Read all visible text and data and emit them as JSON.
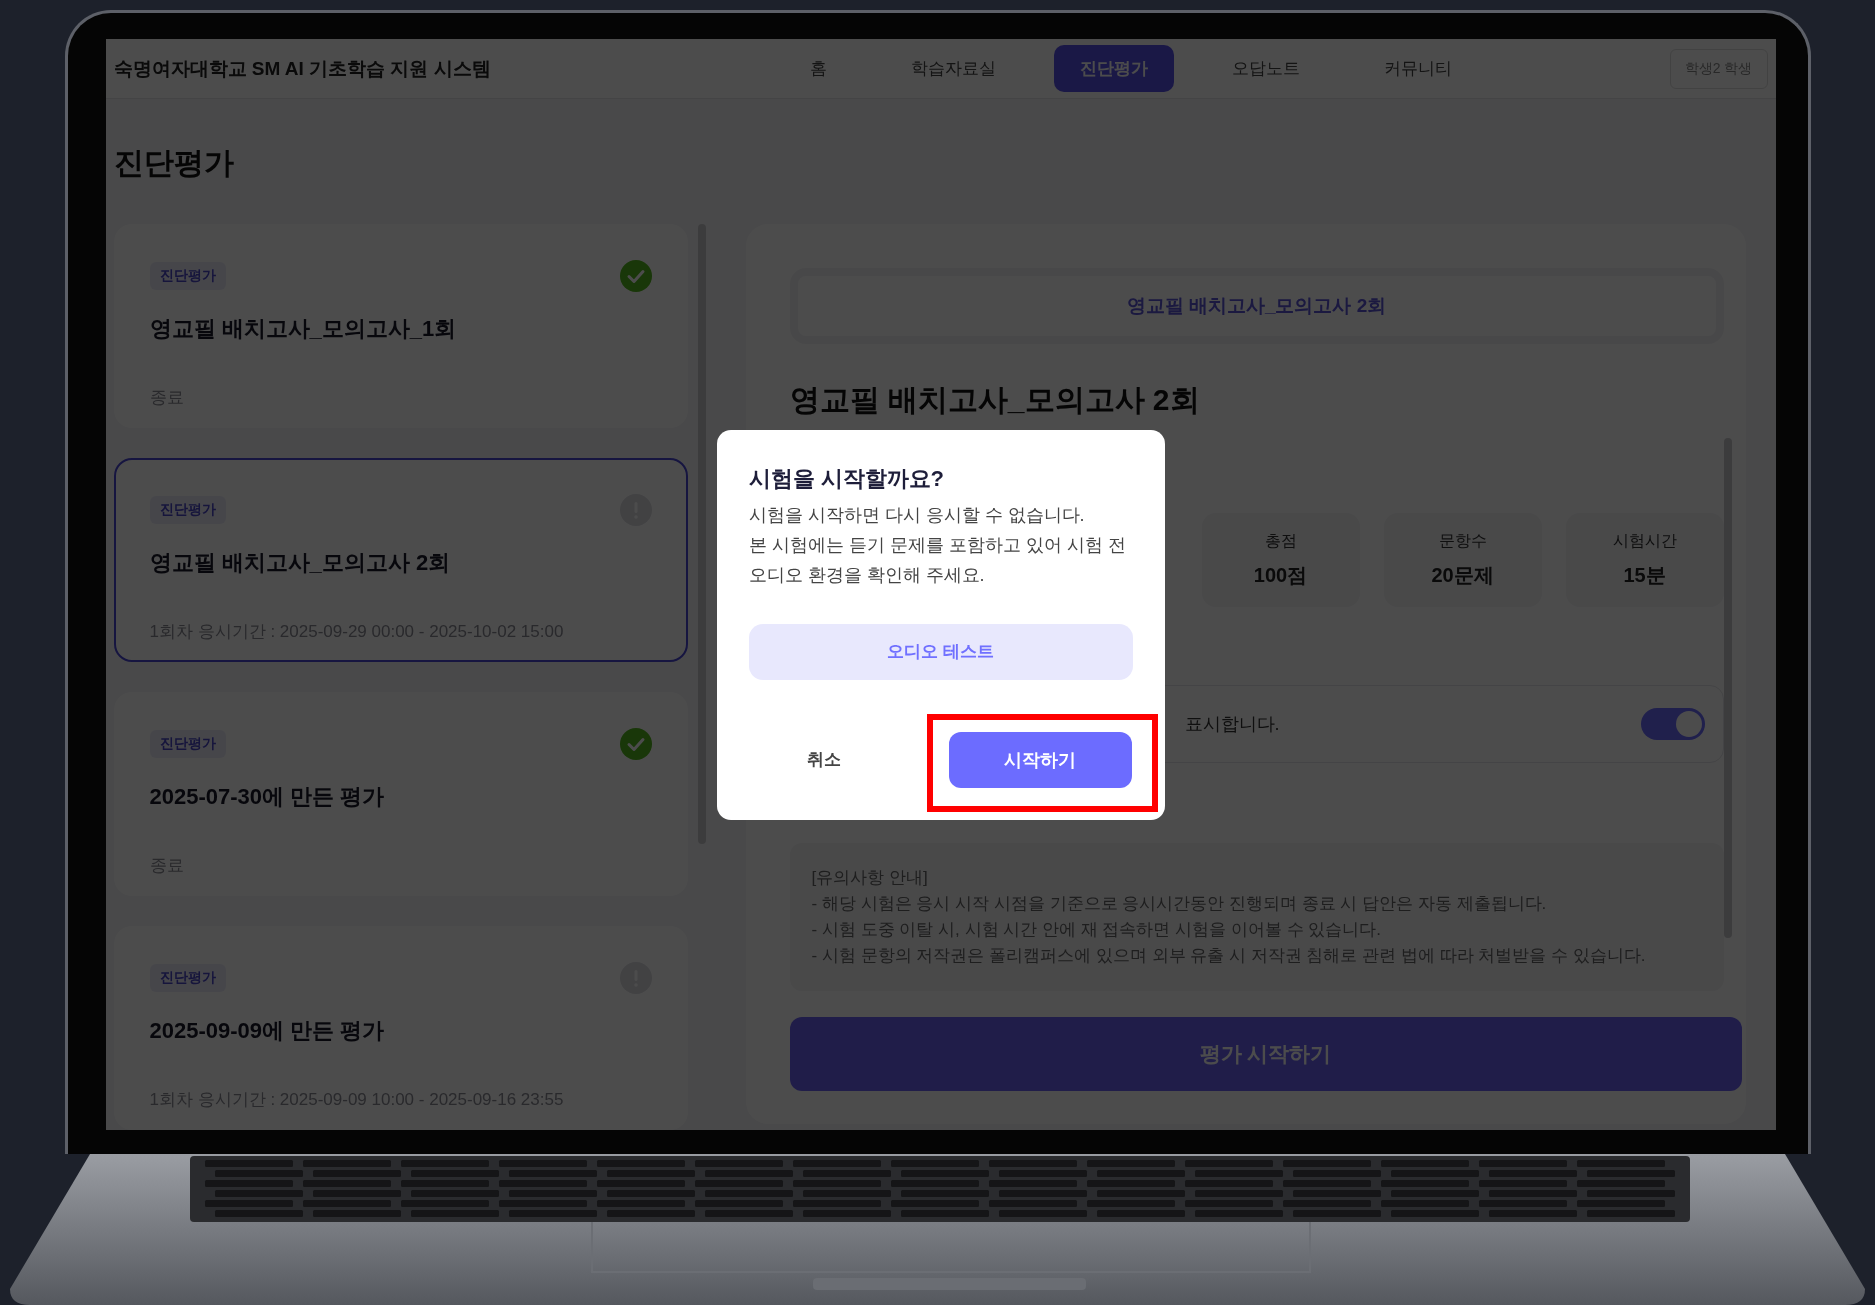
{
  "app": {
    "title": "숙명여자대학교 SM AI 기초학습 지원 시스템",
    "nav": [
      {
        "label": "홈",
        "selected": false
      },
      {
        "label": "학습자료실",
        "selected": false
      },
      {
        "label": "진단평가",
        "selected": true
      },
      {
        "label": "오답노트",
        "selected": false
      },
      {
        "label": "커뮤니티",
        "selected": false
      }
    ],
    "user": "학생2 학생"
  },
  "page_title": "진단평가",
  "exam_list": [
    {
      "tag": "진단평가",
      "title": "영교필 배치고사_모의고사_1회",
      "info": "종료",
      "completed": true,
      "selected": false
    },
    {
      "tag": "진단평가",
      "title": "영교필 배치고사_모의고사 2회",
      "info": "1회차 응시기간 : 2025-09-29 00:00 - 2025-10-02 15:00",
      "completed": false,
      "selected": true
    },
    {
      "tag": "진단평가",
      "title": "2025-07-30에 만든 평가",
      "info": "종료",
      "completed": true,
      "selected": false
    },
    {
      "tag": "진단평가",
      "title": "2025-09-09에 만든 평가",
      "info": "1회차 응시기간 : 2025-09-09 10:00 - 2025-09-16 23:55",
      "completed": false,
      "selected": false
    }
  ],
  "detail": {
    "banner": "영교필 배치고사_모의고사 2회",
    "title": "영교필 배치고사_모의고사 2회",
    "stats": [
      {
        "label": "총점",
        "value": "100점"
      },
      {
        "label": "문항수",
        "value": "20문제"
      },
      {
        "label": "시험시간",
        "value": "15분"
      }
    ],
    "option": {
      "text": "표시합니다.",
      "on": true
    },
    "notice": [
      "[유의사항 안내]",
      "- 해당 시험은 응시 시작 시점을 기준으로 응시시간동안 진행되며 종료 시 답안은 자동 제출됩니다.",
      "- 시험 도중 이탈 시, 시험 시간 안에 재 접속하면 시험을 이어볼 수 있습니다.",
      "- 시험 문항의 저작권은 폴리캠퍼스에 있으며 외부 유출 시 저작권 침해로 관련 법에 따라 처벌받을 수 있습니다."
    ],
    "start_button": "평가 시작하기"
  },
  "dialog": {
    "title": "시험을 시작할까요?",
    "lines": [
      "시험을 시작하면 다시 응시할 수 없습니다.",
      "본 시험에는 듣기 문제를 포함하고 있어 시험 전",
      "오디오 환경을 확인해 주세요."
    ],
    "audio_button": "오디오 테스트",
    "cancel": "취소",
    "confirm": "시작하기",
    "confirm_highlighted": true
  }
}
